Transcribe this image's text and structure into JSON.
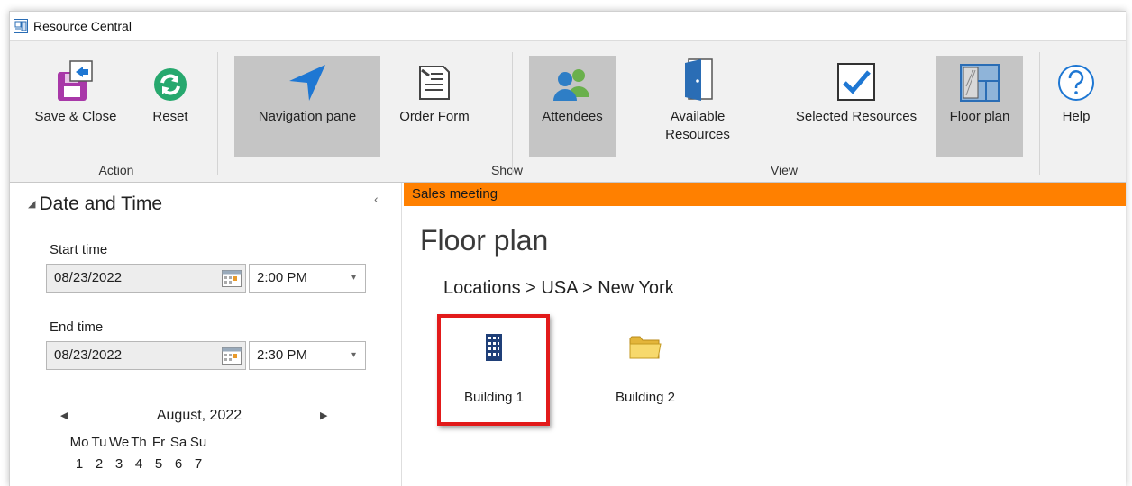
{
  "window": {
    "title": "Resource Central"
  },
  "ribbon": {
    "buttons": {
      "save_close": "Save & Close",
      "reset": "Reset",
      "navigation_pane": "Navigation pane",
      "order_form": "Order Form",
      "attendees": "Attendees",
      "available_resources_1": "Available",
      "available_resources_2": "Resources",
      "selected_resources": "Selected Resources",
      "floor_plan": "Floor plan",
      "help": "Help"
    },
    "groups": {
      "action": "Action",
      "show": "Show",
      "view": "View"
    },
    "active": [
      "navigation_pane",
      "attendees",
      "floor_plan"
    ]
  },
  "nav_pane": {
    "section_title": "Date and Time",
    "start": {
      "label": "Start time",
      "date": "08/23/2022",
      "time": "2:00 PM"
    },
    "end": {
      "label": "End time",
      "date": "08/23/2022",
      "time": "2:30 PM"
    },
    "calendar": {
      "month": "August, 2022",
      "weekdays": [
        "Mo",
        "Tu",
        "We",
        "Th",
        "Fr",
        "Sa",
        "Su"
      ],
      "days": [
        "1",
        "2",
        "3",
        "4",
        "5",
        "6",
        "7"
      ]
    }
  },
  "content": {
    "meeting_title": "Sales meeting",
    "page_title": "Floor plan",
    "breadcrumb": "Locations > USA > New York",
    "tiles": [
      {
        "label": "Building 1",
        "icon": "building-icon",
        "selected": true
      },
      {
        "label": "Building 2",
        "icon": "folder-icon",
        "selected": false
      }
    ]
  },
  "colors": {
    "banner": "#ff8000",
    "highlight": "#e21a1a",
    "accent_blue": "#1e77d3",
    "active_button": "#c5c5c5"
  }
}
